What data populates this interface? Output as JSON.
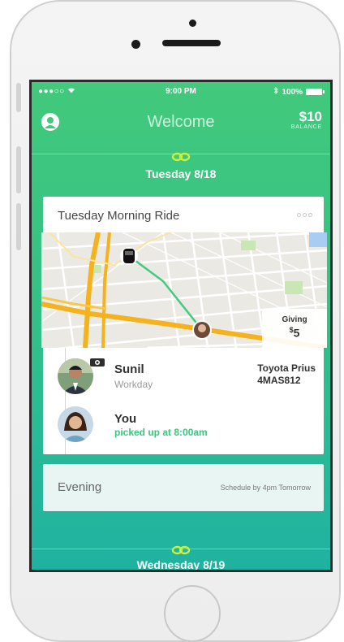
{
  "status_bar": {
    "carrier_signal": "●●●○○",
    "wifi_icon": "wifi-icon",
    "time": "9:00 PM",
    "bluetooth_icon": "bluetooth-icon",
    "battery_percent": "100%"
  },
  "header": {
    "title": "Welcome",
    "balance_amount": "$10",
    "balance_label": "BALANCE",
    "profile_icon": "user-icon"
  },
  "days": [
    {
      "label": "Tuesday 8/18",
      "link_icon": "link-icon",
      "ride_card": {
        "title": "Tuesday Morning Ride",
        "more_icon": "more-options-icon",
        "giving_label": "Giving",
        "giving_currency": "$",
        "giving_amount": "5",
        "driver": {
          "name": "Sunil",
          "company": "Workday",
          "car_model": "Toyota Prius",
          "plate": "4MAS812",
          "badge_icon": "camera-icon"
        },
        "rider": {
          "name": "You",
          "status": "picked up at 8:00am"
        }
      },
      "evening_card": {
        "label": "Evening",
        "schedule_note": "Schedule by 4pm Tomorrow"
      }
    },
    {
      "label": "Wednesday 8/19",
      "link_icon": "link-icon"
    }
  ],
  "colors": {
    "brand_green": "#42c97c",
    "teal": "#20b2a0",
    "status_green_text": "#3bc57e"
  }
}
